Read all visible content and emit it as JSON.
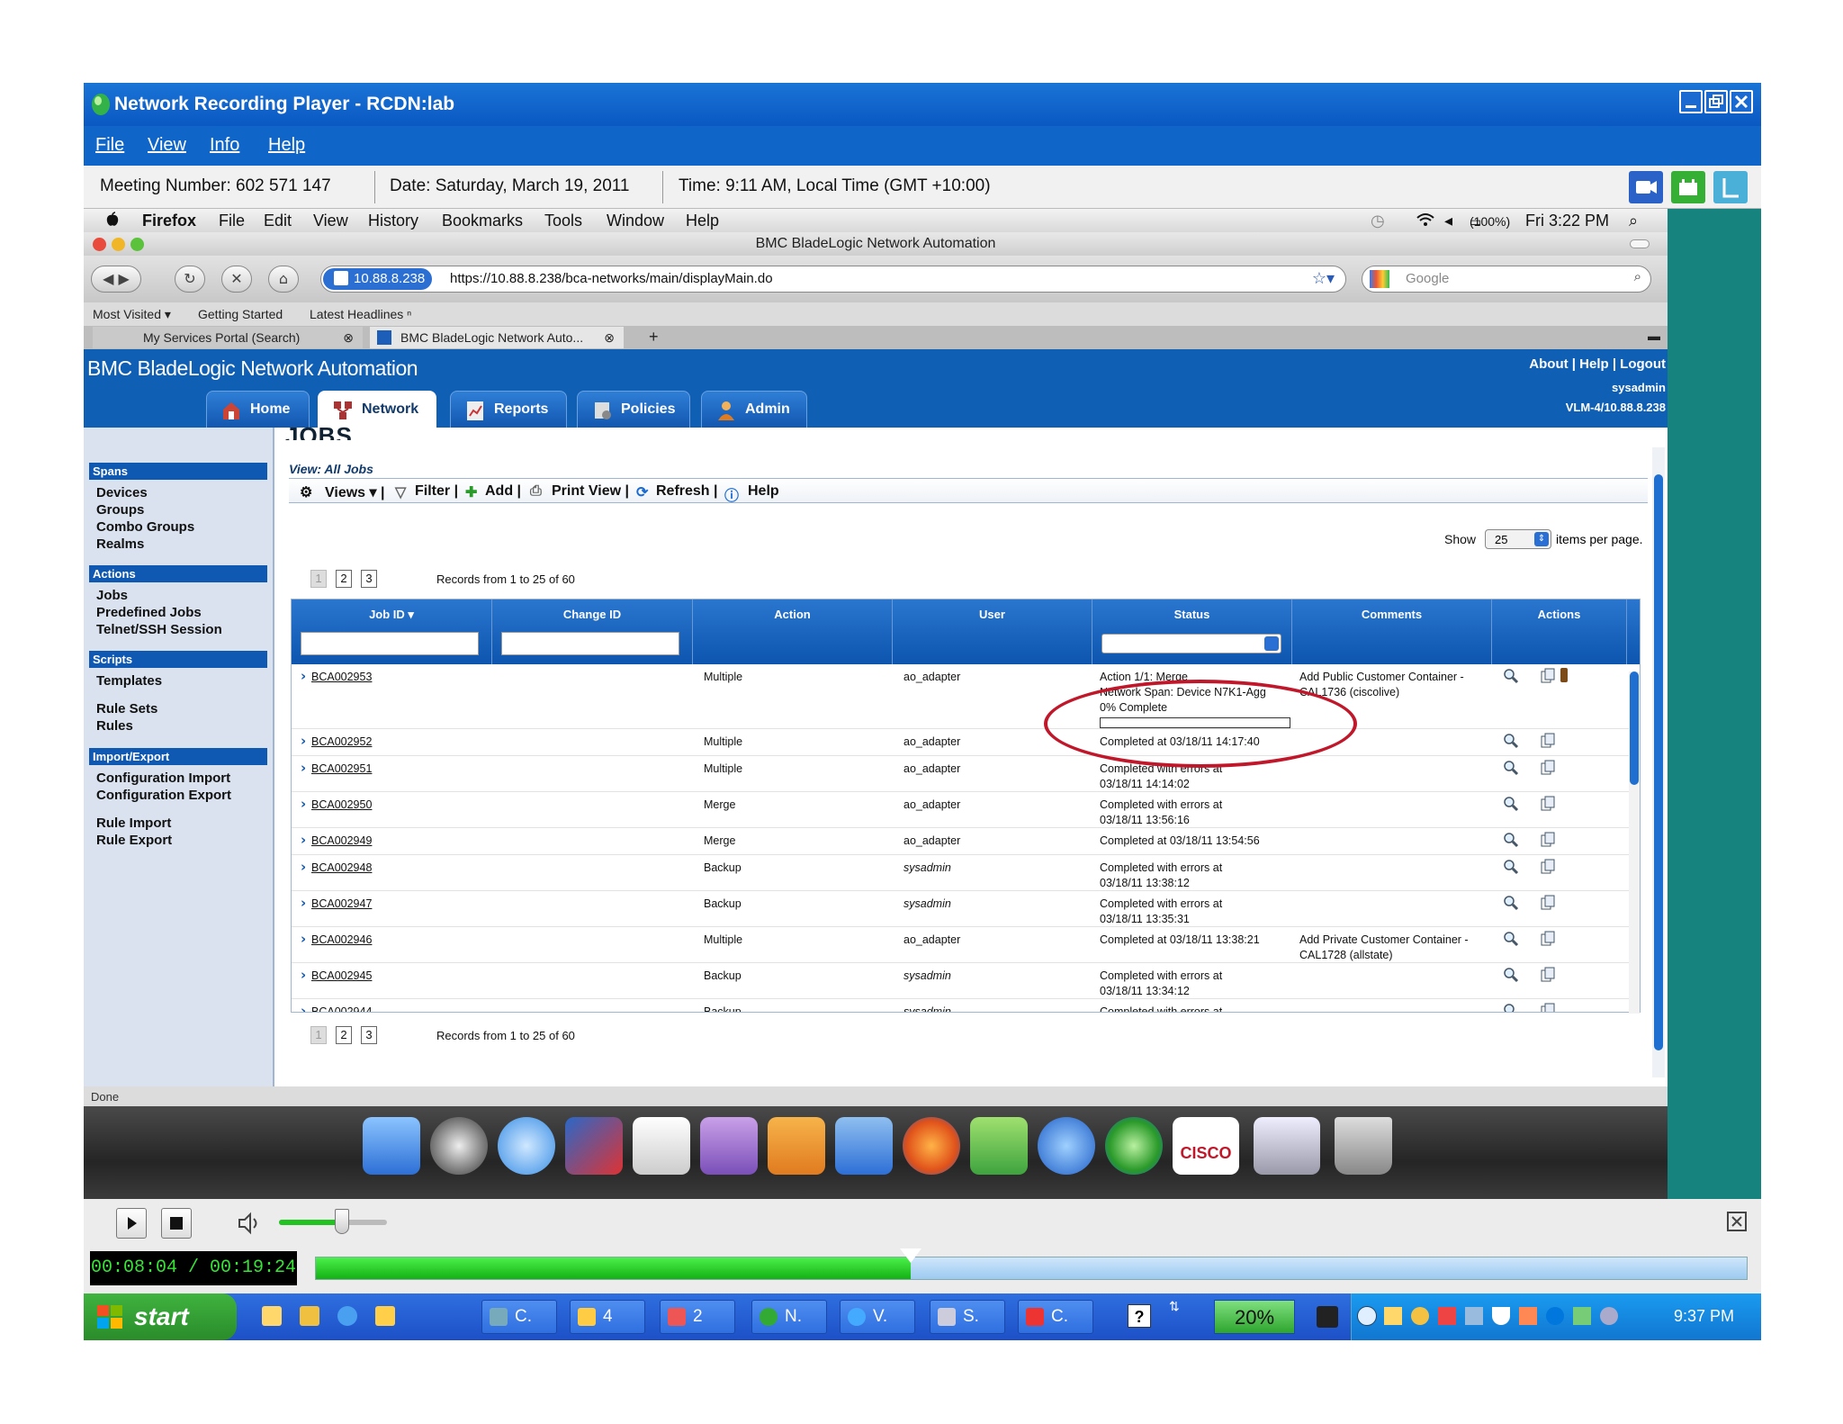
{
  "window": {
    "title": "Network Recording Player - RCDN:lab"
  },
  "menu": [
    "File",
    "View",
    "Info",
    "Help"
  ],
  "meeting": {
    "number": "Meeting Number: 602 571 147",
    "date": "Date: Saturday, March 19, 2011",
    "time": "Time: 9:11 AM, Local Time (GMT +10:00)"
  },
  "mac_menu": {
    "apple": "",
    "items": [
      "Firefox",
      "File",
      "Edit",
      "View",
      "History",
      "Bookmarks",
      "Tools",
      "Window",
      "Help"
    ],
    "battery": "(100%)",
    "clock": "Fri 3:22 PM"
  },
  "browser": {
    "title": "BMC BladeLogic Network Automation",
    "url_host": "10.88.8.238",
    "url": "https://10.88.8.238/bca-networks/main/displayMain.do",
    "search_placeholder": "Google",
    "bookmarks": [
      "Most Visited ▾",
      "Getting Started",
      "Latest Headlines ⁿ"
    ],
    "tabs": [
      "My Services Portal (Search)",
      "BMC BladeLogic Network Auto..."
    ],
    "status": "Done"
  },
  "app": {
    "name": "BMC BladeLogic Network Automation",
    "links": "About | Help | Logout",
    "user": "sysadmin",
    "host": "VLM-4/10.88.8.238",
    "tabs": [
      "Home",
      "Network",
      "Reports",
      "Policies",
      "Admin"
    ]
  },
  "sidebar": {
    "sections": [
      {
        "title": "Spans",
        "items": [
          "Devices",
          "Groups",
          "Combo Groups",
          "Realms"
        ]
      },
      {
        "title": "Actions",
        "items": [
          "Jobs",
          "Predefined Jobs",
          "Telnet/SSH Session"
        ]
      },
      {
        "title": "Scripts",
        "items": [
          "Templates",
          "Rule Sets",
          "Rules"
        ]
      },
      {
        "title": "Import/Export",
        "items": [
          "Configuration Import",
          "Configuration Export",
          "Rule Import",
          "Rule Export"
        ]
      }
    ]
  },
  "main": {
    "heading": "JOBS",
    "view": "View: All Jobs",
    "toolbar": [
      "Views ▾ |",
      "Filter |",
      "Add |",
      "Print View |",
      "Refresh |",
      "Help"
    ],
    "show_label": "Show",
    "per_page": "25",
    "per_page_suffix": "items per page.",
    "pages": [
      "1",
      "2",
      "3"
    ],
    "records": "Records from 1 to 25 of 60",
    "columns": [
      "Job ID ▾",
      "Change ID",
      "Action",
      "User",
      "Status",
      "Comments",
      "Actions"
    ],
    "rows": [
      {
        "id": "BCA002953",
        "action": "Multiple",
        "user": "ao_adapter",
        "status": [
          "Action 1/1: Merge",
          "Network Span: Device N7K1-Agg",
          "0% Complete"
        ],
        "comment": [
          "Add Public Customer Container -",
          "CAL1736 (ciscolive)"
        ],
        "progress": 0
      },
      {
        "id": "BCA002952",
        "action": "Multiple",
        "user": "ao_adapter",
        "status": [
          "Completed at 03/18/11 14:17:40"
        ],
        "comment": []
      },
      {
        "id": "BCA002951",
        "action": "Multiple",
        "user": "ao_adapter",
        "status": [
          "Completed with errors at",
          "03/18/11 14:14:02"
        ],
        "comment": []
      },
      {
        "id": "BCA002950",
        "action": "Merge",
        "user": "ao_adapter",
        "status": [
          "Completed with errors at",
          "03/18/11 13:56:16"
        ],
        "comment": []
      },
      {
        "id": "BCA002949",
        "action": "Merge",
        "user": "ao_adapter",
        "status": [
          "Completed at 03/18/11 13:54:56"
        ],
        "comment": []
      },
      {
        "id": "BCA002948",
        "action": "Backup",
        "user": "sysadmin",
        "status": [
          "Completed with errors at",
          "03/18/11 13:38:12"
        ],
        "comment": []
      },
      {
        "id": "BCA002947",
        "action": "Backup",
        "user": "sysadmin",
        "status": [
          "Completed with errors at",
          "03/18/11 13:35:31"
        ],
        "comment": []
      },
      {
        "id": "BCA002946",
        "action": "Multiple",
        "user": "ao_adapter",
        "status": [
          "Completed at 03/18/11 13:38:21"
        ],
        "comment": [
          "Add Private Customer Container -",
          "CAL1728 (allstate)"
        ]
      },
      {
        "id": "BCA002945",
        "action": "Backup",
        "user": "sysadmin",
        "status": [
          "Completed with errors at",
          "03/18/11 13:34:12"
        ],
        "comment": []
      },
      {
        "id": "BCA002944",
        "action": "Backup",
        "user": "sysadmin",
        "status": [
          "Completed with errors at"
        ],
        "comment": []
      }
    ]
  },
  "dock": {
    "cisco_label": "CISCO"
  },
  "player": {
    "time": "00:08:04 / 00:19:24",
    "progress": 0.4157,
    "volume": 0.58
  },
  "taskbar": {
    "start": "start",
    "buttons": [
      "C.",
      "4",
      "2",
      "N.",
      "V.",
      "S.",
      "C."
    ],
    "percent": "20%",
    "clock": "9:37 PM"
  },
  "colors": {
    "accent": "#0f5fb5",
    "annotation": "#c0182a",
    "player_green": "#23c223"
  }
}
